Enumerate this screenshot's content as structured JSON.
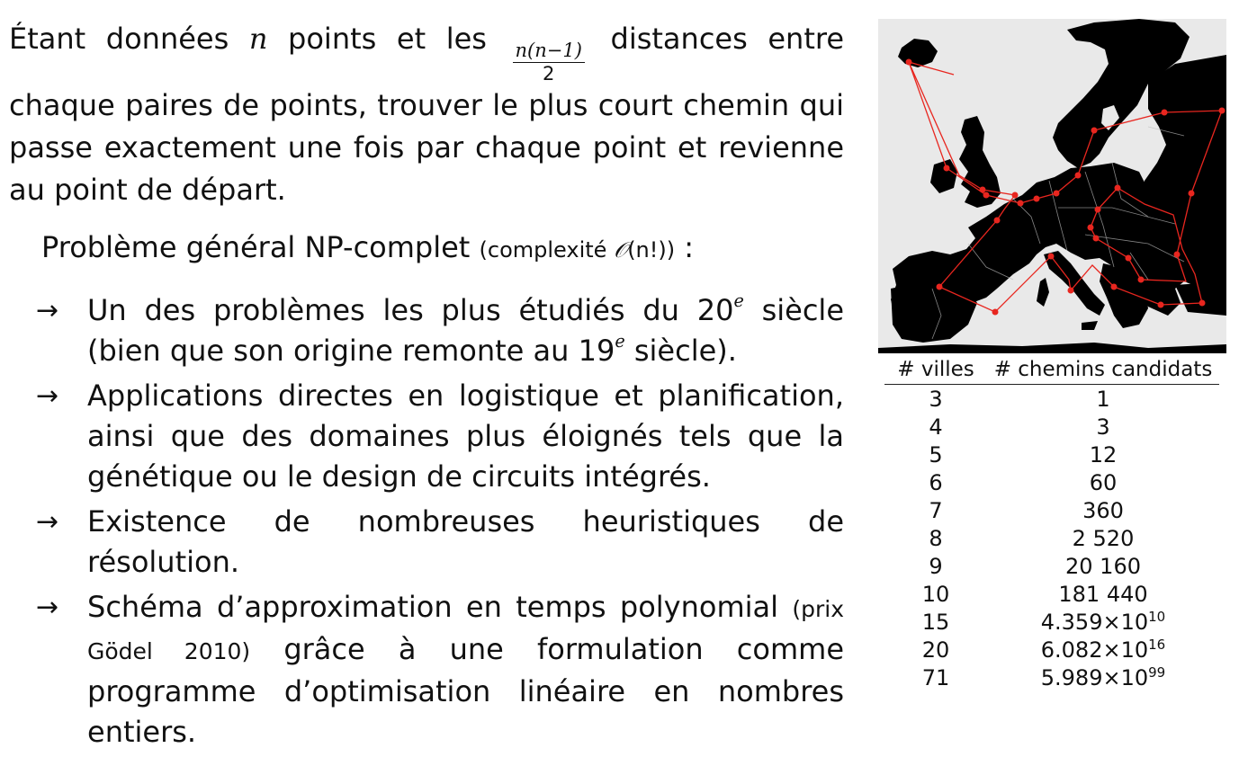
{
  "intro": {
    "part1": "Étant données ",
    "var_n": "n",
    "part2": " points et les ",
    "frac_num": "n(n−1)",
    "frac_den": "2",
    "part3": " distances entre chaque paires de points, trouver le plus court chemin qui passe exactement une fois par chaque point et revienne au point de départ."
  },
  "problem": {
    "main": "Problème général NP-complet ",
    "complexity_open": "(complexité ",
    "complexity_symbol": "𝒪",
    "complexity_arg": "(n!)",
    "complexity_close": ")",
    "colon": " :"
  },
  "bullets": [
    {
      "arrow": "→",
      "text_a": "Un des problèmes les plus étudiés du 20",
      "sup_a": "e",
      "text_b": " siècle (bien que son origine remonte au 19",
      "sup_b": "e",
      "text_c": " siècle)."
    },
    {
      "arrow": "→",
      "text": "Applications directes en logistique et planification, ainsi que des domaines plus éloignés tels que la génétique ou le design de circuits intégrés."
    },
    {
      "arrow": "→",
      "text": "Existence de nombreuses heuristiques de résolution."
    },
    {
      "arrow": "→",
      "text_a": "Schéma d’approximation en temps polynomial ",
      "small": "(prix Gödel 2010)",
      "text_b": " grâce à une formulation comme programme d’optimisation linéaire en nombres entiers."
    }
  ],
  "map": {
    "land_color": "#000000",
    "sea_color": "#e9e9e9",
    "route_color": "#e8261f",
    "city_count": 24
  },
  "table": {
    "headers": [
      "# villes",
      "# chemins candidats"
    ],
    "rows": [
      {
        "villes": "3",
        "chemins": "1"
      },
      {
        "villes": "4",
        "chemins": "3"
      },
      {
        "villes": "5",
        "chemins": "12"
      },
      {
        "villes": "6",
        "chemins": "60"
      },
      {
        "villes": "7",
        "chemins": "360"
      },
      {
        "villes": "8",
        "chemins": "2 520"
      },
      {
        "villes": "9",
        "chemins": "20 160"
      },
      {
        "villes": "10",
        "chemins": "181 440"
      },
      {
        "villes": "15",
        "chemins": "4.359×10",
        "exp": "10"
      },
      {
        "villes": "20",
        "chemins": "6.082×10",
        "exp": "16"
      },
      {
        "villes": "71",
        "chemins": "5.989×10",
        "exp": "99"
      }
    ]
  }
}
